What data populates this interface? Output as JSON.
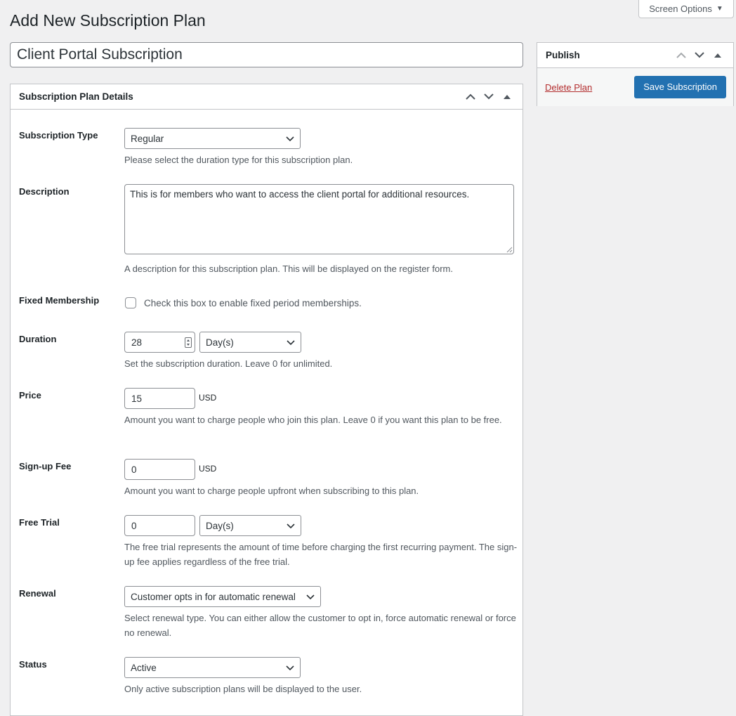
{
  "screen_options": {
    "label": "Screen Options"
  },
  "page": {
    "title": "Add New Subscription Plan",
    "plan_name": "Client Portal Subscription"
  },
  "details": {
    "heading": "Subscription Plan Details",
    "subscription_type": {
      "label": "Subscription Type",
      "value": "Regular",
      "desc": "Please select the duration type for this subscription plan."
    },
    "description": {
      "label": "Description",
      "value": "This is for members who want to access the client portal for additional resources.",
      "desc": "A description for this subscription plan. This will be displayed on the register form."
    },
    "fixed_membership": {
      "label": "Fixed Membership",
      "checkbox_label": "Check this box to enable fixed period memberships."
    },
    "duration": {
      "label": "Duration",
      "value": "28",
      "unit": "Day(s)",
      "desc": "Set the subscription duration. Leave 0 for unlimited."
    },
    "price": {
      "label": "Price",
      "value": "15",
      "currency": "USD",
      "desc": "Amount you want to charge people who join this plan. Leave 0 if you want this plan to be free."
    },
    "signup_fee": {
      "label": "Sign-up Fee",
      "value": "0",
      "currency": "USD",
      "desc": "Amount you want to charge people upfront when subscribing to this plan."
    },
    "free_trial": {
      "label": "Free Trial",
      "value": "0",
      "unit": "Day(s)",
      "desc": "The free trial represents the amount of time before charging the first recurring payment. The sign-up fee applies regardless of the free trial."
    },
    "renewal": {
      "label": "Renewal",
      "value": "Customer opts in for automatic renewal",
      "desc": "Select renewal type. You can either allow the customer to opt in, force automatic renewal or force no renewal."
    },
    "status": {
      "label": "Status",
      "value": "Active",
      "desc": "Only active subscription plans will be displayed to the user."
    }
  },
  "publish": {
    "heading": "Publish",
    "delete_label": "Delete Plan",
    "save_label": "Save Subscription"
  },
  "icons": {
    "move_up": "chevron-up-icon",
    "move_down": "chevron-down-icon",
    "toggle": "triangle-up-icon",
    "select_arrow": "chevron-down-icon"
  }
}
